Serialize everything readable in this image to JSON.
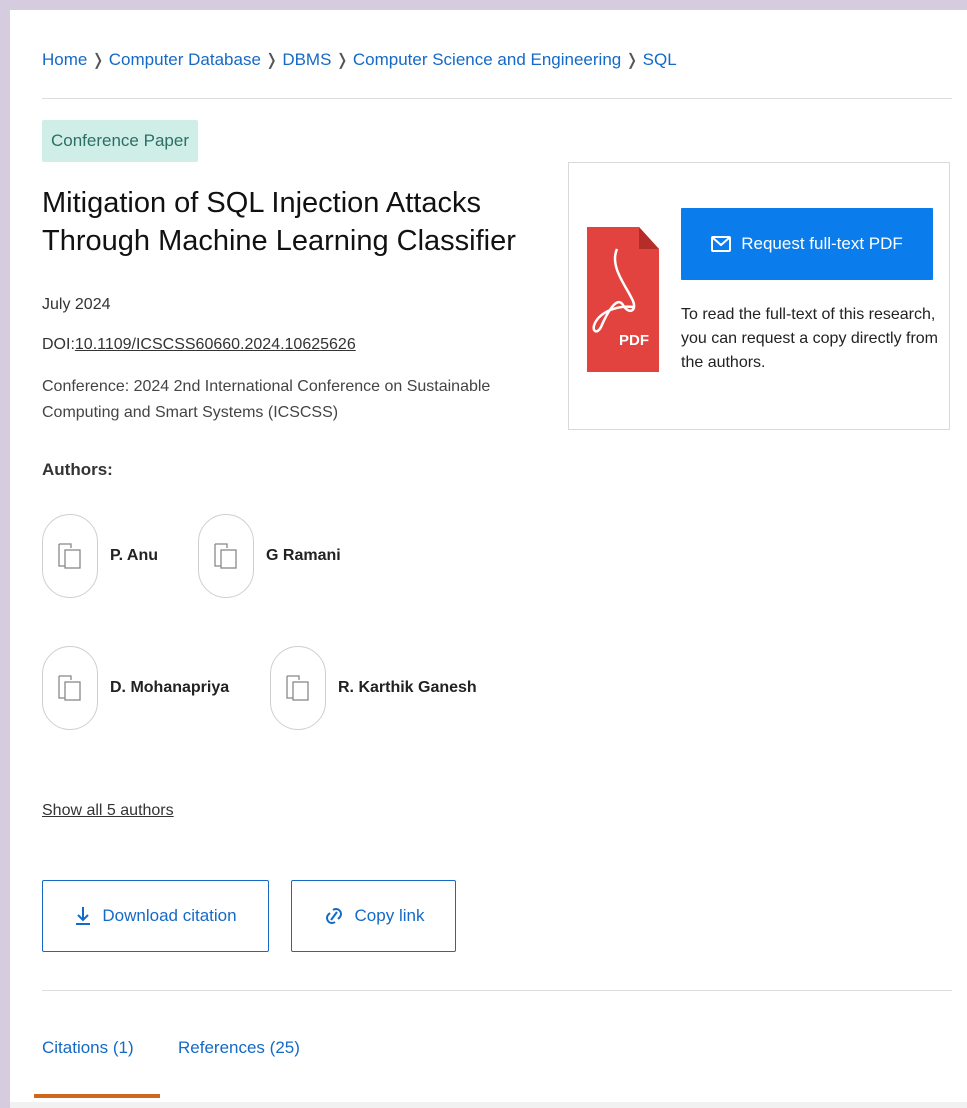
{
  "breadcrumb": {
    "items": [
      "Home",
      "Computer Database",
      "DBMS",
      "Computer Science and Engineering",
      "SQL"
    ]
  },
  "publication": {
    "type_badge": "Conference Paper",
    "title": "Mitigation of SQL Injection Attacks Through Machine Learning Classifier",
    "date": "July 2024",
    "doi_prefix": "DOI:",
    "doi": "10.1109/ICSCSS60660.2024.10625626",
    "conference": "Conference: 2024 2nd International Conference on Sustainable Computing and Smart Systems (ICSCSS)"
  },
  "authors": {
    "label": "Authors:",
    "list": [
      "P. Anu",
      "G Ramani",
      "D. Mohanapriya",
      "R. Karthik Ganesh"
    ],
    "show_all": "Show all 5 authors"
  },
  "actions": {
    "download_citation": "Download citation",
    "copy_link": "Copy link"
  },
  "tabs": [
    {
      "label": "Citations (1)",
      "active": true
    },
    {
      "label": "References (25)",
      "active": false
    }
  ],
  "pdf_panel": {
    "icon_label": "PDF",
    "request_button": "Request full-text PDF",
    "description": "To read the full-text of this research, you can request a copy directly from the authors."
  },
  "colors": {
    "link": "#1569c7",
    "primary_button": "#0a7cec",
    "badge_bg": "#cfeee8",
    "pdf_red": "#e2433e",
    "tab_active": "#d0651c",
    "frame": "#d6cce0"
  },
  "icons": [
    "chevron-right-icon",
    "author-placeholder-icon",
    "download-icon",
    "link-icon",
    "mail-icon",
    "pdf-file-icon"
  ]
}
